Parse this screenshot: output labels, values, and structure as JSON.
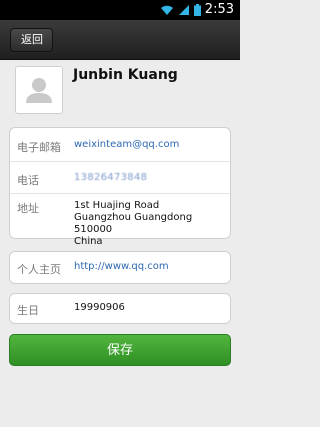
{
  "status_bar": {
    "time": "2:53",
    "icons": [
      "wifi-icon",
      "signal-icon",
      "battery-icon"
    ]
  },
  "nav": {
    "back_label": "返回"
  },
  "profile": {
    "name": "Junbin Kuang",
    "avatar_icon": "person-icon"
  },
  "fields": {
    "email": {
      "label": "电子邮箱",
      "value": "weixinteam@qq.com"
    },
    "phone": {
      "label": "电话",
      "value": "13826473848"
    },
    "address": {
      "label": "地址",
      "lines": [
        "1st Huajing Road",
        "Guangzhou Guangdong 510000",
        "China"
      ]
    },
    "homepage": {
      "label": "个人主页",
      "value": "http://www.qq.com"
    },
    "birthday": {
      "label": "生日",
      "value": "19990906"
    }
  },
  "actions": {
    "save_label": "保存"
  },
  "colors": {
    "link": "#2f69b3",
    "save_green": "#3a9e2e",
    "nav_dark": "#2b2b2b"
  }
}
